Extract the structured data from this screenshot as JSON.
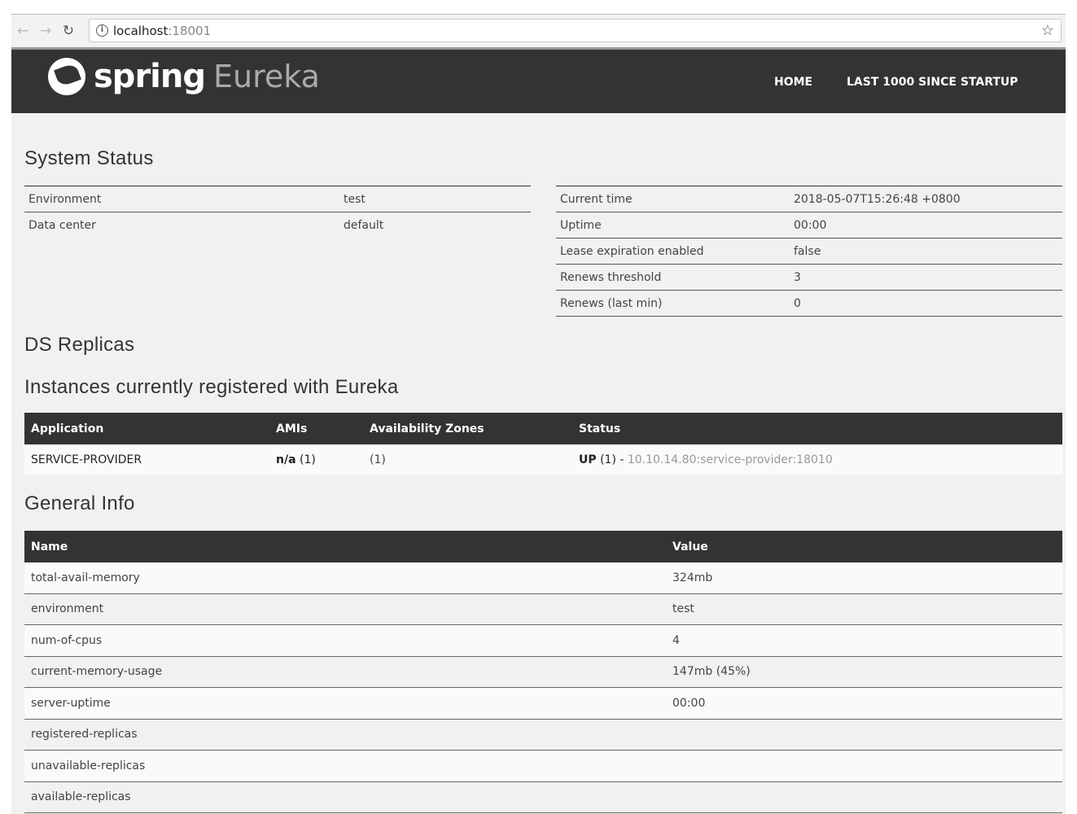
{
  "browser": {
    "host": "localhost",
    "port": ":18001"
  },
  "header": {
    "brand": "spring",
    "product": "Eureka",
    "menu": [
      "HOME",
      "LAST 1000 SINCE STARTUP"
    ]
  },
  "system_status": {
    "title": "System Status",
    "left": [
      {
        "k": "Environment",
        "v": "test"
      },
      {
        "k": "Data center",
        "v": "default"
      }
    ],
    "right": [
      {
        "k": "Current time",
        "v": "2018-05-07T15:26:48 +0800"
      },
      {
        "k": "Uptime",
        "v": "00:00"
      },
      {
        "k": "Lease expiration enabled",
        "v": "false"
      },
      {
        "k": "Renews threshold",
        "v": "3"
      },
      {
        "k": "Renews (last min)",
        "v": "0"
      }
    ]
  },
  "ds_replicas": {
    "title": "DS Replicas"
  },
  "instances": {
    "title": "Instances currently registered with Eureka",
    "columns": [
      "Application",
      "AMIs",
      "Availability Zones",
      "Status"
    ],
    "rows": [
      {
        "app": "SERVICE-PROVIDER",
        "ami": "n/a",
        "ami_count": " (1)",
        "zones": "(1)",
        "status": "UP",
        "status_count": " (1) - ",
        "instance": "10.10.14.80:service-provider:18010"
      }
    ]
  },
  "general_info": {
    "title": "General Info",
    "columns": [
      "Name",
      "Value"
    ],
    "rows": [
      {
        "k": "total-avail-memory",
        "v": "324mb"
      },
      {
        "k": "environment",
        "v": "test"
      },
      {
        "k": "num-of-cpus",
        "v": "4"
      },
      {
        "k": "current-memory-usage",
        "v": "147mb (45%)"
      },
      {
        "k": "server-uptime",
        "v": "00:00"
      },
      {
        "k": "registered-replicas",
        "v": ""
      },
      {
        "k": "unavailable-replicas",
        "v": ""
      },
      {
        "k": "available-replicas",
        "v": ""
      }
    ]
  }
}
